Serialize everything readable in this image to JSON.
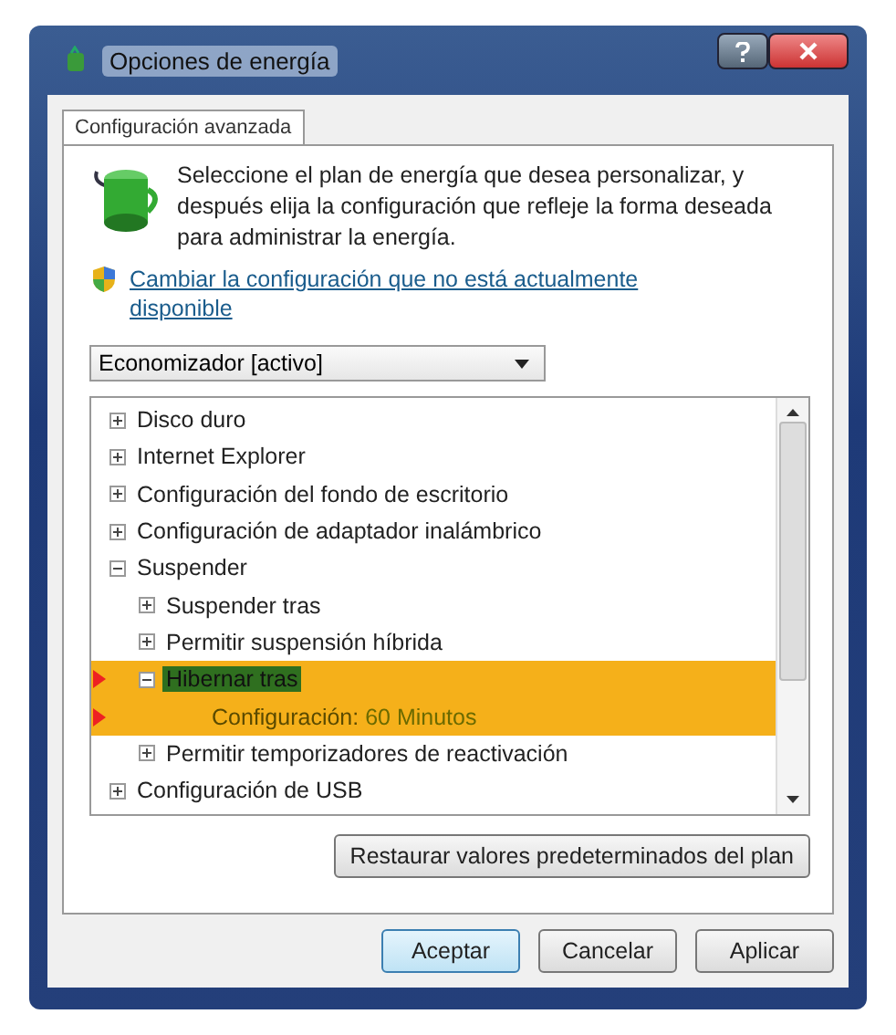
{
  "window": {
    "title": "Opciones de energía"
  },
  "tabs": [
    {
      "label": "Configuración avanzada",
      "selected": true
    }
  ],
  "intro": "Seleccione el plan de energía que desea personalizar, y después elija la configuración que refleje la forma deseada para administrar la energía.",
  "link": "Cambiar la configuración que no está actualmente disponible",
  "plan_dropdown": {
    "value": "Economizador [activo]"
  },
  "tree": [
    {
      "label": "Disco duro",
      "expanded": false,
      "selected": false,
      "highlighted": false
    },
    {
      "label": "Internet Explorer",
      "expanded": false,
      "selected": false,
      "highlighted": false
    },
    {
      "label": "Configuración del fondo de escritorio",
      "expanded": false,
      "selected": false,
      "highlighted": false
    },
    {
      "label": "Configuración de adaptador inalámbrico",
      "expanded": false,
      "selected": false,
      "highlighted": false
    },
    {
      "label": "Suspender",
      "expanded": true,
      "selected": false,
      "highlighted": false,
      "children": [
        {
          "label": "Suspender tras",
          "expanded": false,
          "selected": false,
          "highlighted": false
        },
        {
          "label": "Permitir suspensión híbrida",
          "expanded": false,
          "selected": false,
          "highlighted": false
        },
        {
          "label": "Hibernar tras",
          "expanded": true,
          "selected": true,
          "highlighted": true,
          "children": [
            {
              "kind": "setting",
              "label": "Configuración:",
              "value": "60 Minutos",
              "highlighted": true
            }
          ]
        },
        {
          "label": "Permitir temporizadores de reactivación",
          "expanded": false,
          "selected": false,
          "highlighted": false
        }
      ]
    },
    {
      "label": "Configuración de USB",
      "expanded": false,
      "selected": false,
      "highlighted": false
    }
  ],
  "restore_button": "Restaurar valores predeterminados del plan",
  "buttons": [
    {
      "label": "Aceptar",
      "default": true
    },
    {
      "label": "Cancelar",
      "default": false
    },
    {
      "label": "Aplicar",
      "default": false
    }
  ]
}
